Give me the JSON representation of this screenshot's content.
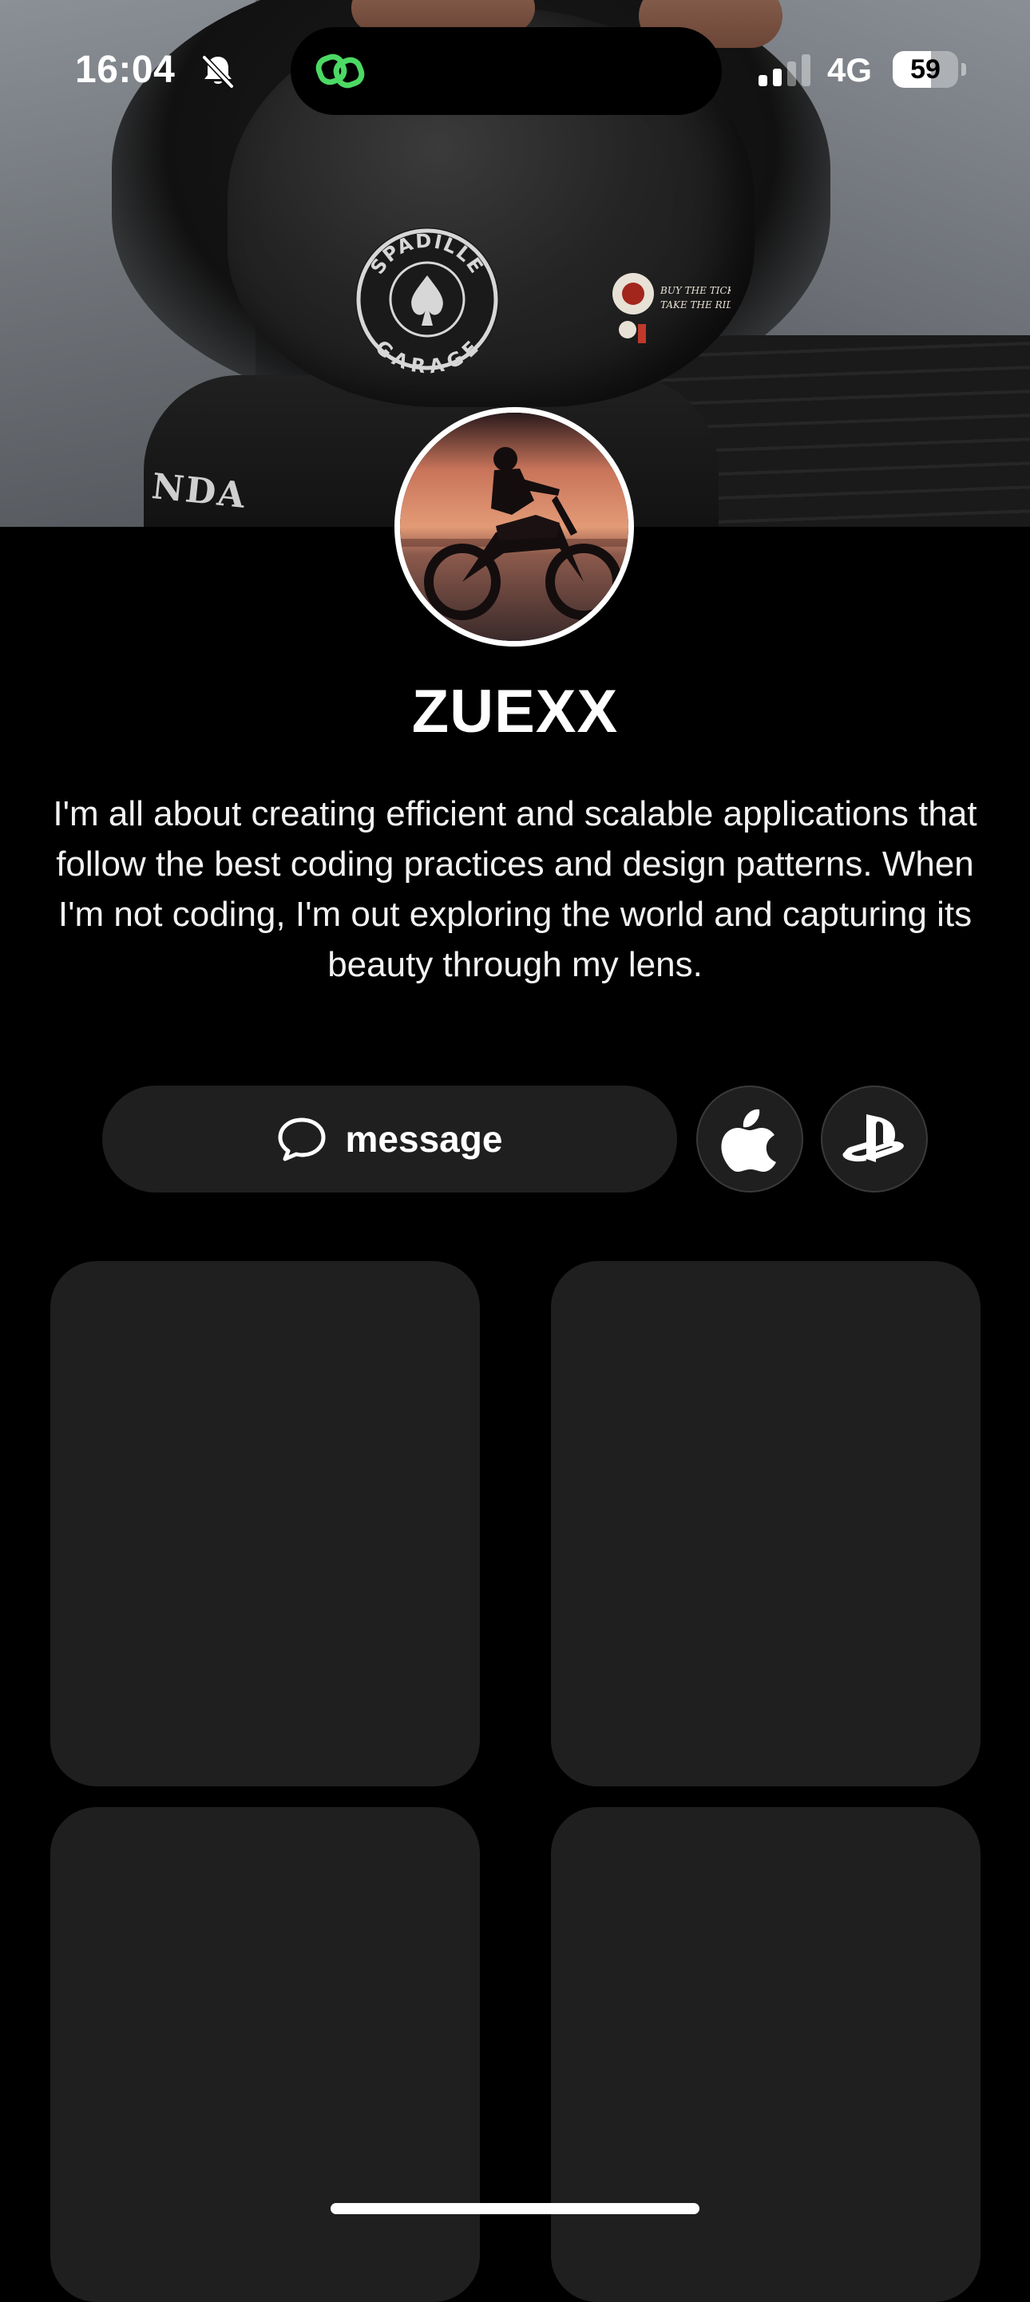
{
  "status_bar": {
    "time": "16:04",
    "network": "4G",
    "battery_level": "59",
    "battery_fraction": 0.59,
    "icons": [
      "bell-slash-icon",
      "link-icon",
      "signal-icon",
      "battery-icon"
    ],
    "link_icon_color": "#4cd964"
  },
  "profile": {
    "name": "ZUEXX",
    "bio": "I'm all about creating efficient and scalable applications that follow the best coding practices and design patterns. When I'm not coding, I'm out exploring the world and capturing its beauty through my lens."
  },
  "cover": {
    "emblem_lines": [
      "SPADILLE",
      "GARAGE"
    ],
    "tank_text": "NDA",
    "sticker_lines": [
      "BUY THE TICKET",
      "TAKE THE RIDE"
    ]
  },
  "actions": {
    "message_label": "message",
    "message_icon": "speech-bubble-icon",
    "apple_icon": "apple-logo-icon",
    "playstation_icon": "playstation-logo-icon"
  },
  "cards": [
    {
      "id": "card-1"
    },
    {
      "id": "card-2"
    },
    {
      "id": "card-3"
    },
    {
      "id": "card-4"
    }
  ],
  "colors": {
    "background": "#000000",
    "card": "#1f1f1f",
    "text": "#ffffff",
    "accent_green": "#4cd964"
  }
}
